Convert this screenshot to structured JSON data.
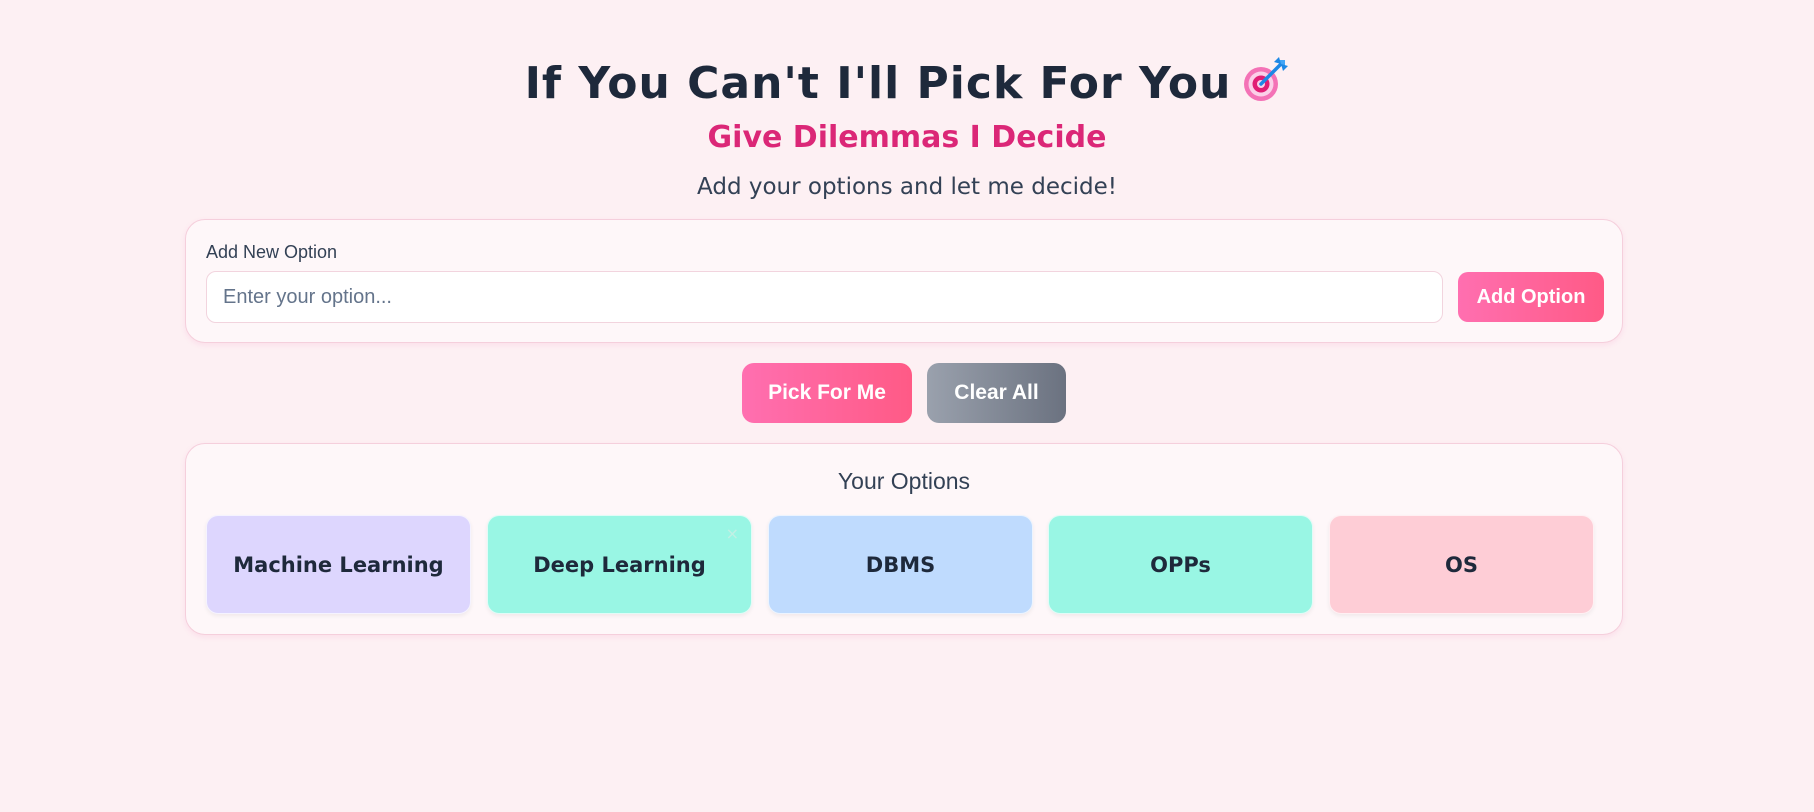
{
  "header": {
    "title": "If You Can't I'll Pick For You",
    "title_icon": "target-dart-icon",
    "subtitle": "Give Dilemmas I Decide",
    "tagline": "Add your options and let me decide!"
  },
  "add_option": {
    "label": "Add New Option",
    "input_value": "",
    "input_placeholder": "Enter your option...",
    "button_label": "Add Option"
  },
  "actions": {
    "pick_label": "Pick For Me",
    "clear_label": "Clear All"
  },
  "options_panel": {
    "title": "Your Options",
    "items": [
      {
        "label": "Machine Learning",
        "color": "#ddd6fe"
      },
      {
        "label": "Deep Learning",
        "color": "#99f6e4",
        "remove_glyph": "×"
      },
      {
        "label": "DBMS",
        "color": "#bfdbfe"
      },
      {
        "label": "OPPs",
        "color": "#99f6e4"
      },
      {
        "label": "OS",
        "color": "#fecdd6"
      }
    ]
  },
  "colors": {
    "background": "#fdf0f3",
    "accent_pink": "#ff6fb0",
    "subtitle_pink": "#db2777",
    "gray_button": "#6b7280",
    "text_dark": "#1e293b"
  }
}
